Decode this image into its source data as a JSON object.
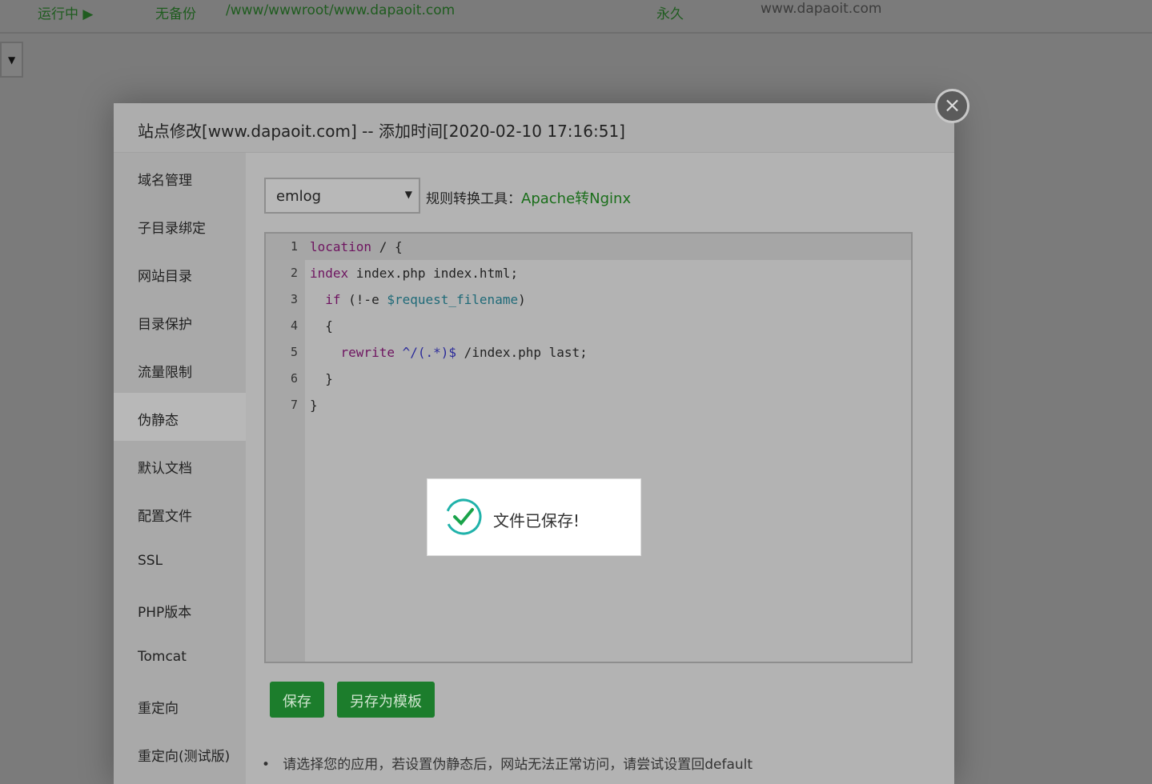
{
  "background_row": {
    "status": "运行中 ▶",
    "backup": "无备份",
    "path": "/www/wwwroot/www.dapaoit.com",
    "expiry": "永久",
    "note": "www.dapaoit.com"
  },
  "bg_select_arrow": "▼",
  "modal": {
    "title": "站点修改[www.dapaoit.com] -- 添加时间[2020-02-10 17:16:51]",
    "close_icon": "×",
    "sidebar": [
      "域名管理",
      "子目录绑定",
      "网站目录",
      "目录保护",
      "流量限制",
      "伪静态",
      "默认文档",
      "配置文件",
      "SSL",
      "PHP版本",
      "Tomcat",
      "重定向",
      "重定向(测试版)"
    ],
    "active_item": "伪静态",
    "template_select": {
      "value": "emlog",
      "arrow": "▼"
    },
    "tool_label": "规则转换工具：",
    "tool_link": "Apache转Nginx",
    "editor_lines": [
      {
        "n": "1",
        "code": [
          {
            "t": "location",
            "c": "k"
          },
          {
            "t": " / {",
            "c": ""
          }
        ]
      },
      {
        "n": "2",
        "code": [
          {
            "t": "index",
            "c": "k"
          },
          {
            "t": " index.php index.html;",
            "c": ""
          }
        ]
      },
      {
        "n": "3",
        "code": [
          {
            "t": "  if",
            "c": "k"
          },
          {
            "t": " (!-e ",
            "c": ""
          },
          {
            "t": "$request_filename",
            "c": "v"
          },
          {
            "t": ")",
            "c": ""
          }
        ]
      },
      {
        "n": "4",
        "code": [
          {
            "t": "  {",
            "c": ""
          }
        ]
      },
      {
        "n": "5",
        "code": [
          {
            "t": "    rewrite",
            "c": "k"
          },
          {
            "t": " ",
            "c": ""
          },
          {
            "t": "^/(.*)$",
            "c": "r"
          },
          {
            "t": " /index.php last;",
            "c": ""
          }
        ]
      },
      {
        "n": "6",
        "code": [
          {
            "t": "  }",
            "c": ""
          }
        ]
      },
      {
        "n": "7",
        "code": [
          {
            "t": "}",
            "c": ""
          }
        ]
      }
    ],
    "save_label": "保存",
    "save_template_label": "另存为模板",
    "note": "请选择您的应用，若设置伪静态后，网站无法正常访问，请尝试设置回default"
  },
  "toast": {
    "message": "文件已保存!",
    "icon": "check-circle-icon",
    "color": "#20b2aa"
  }
}
